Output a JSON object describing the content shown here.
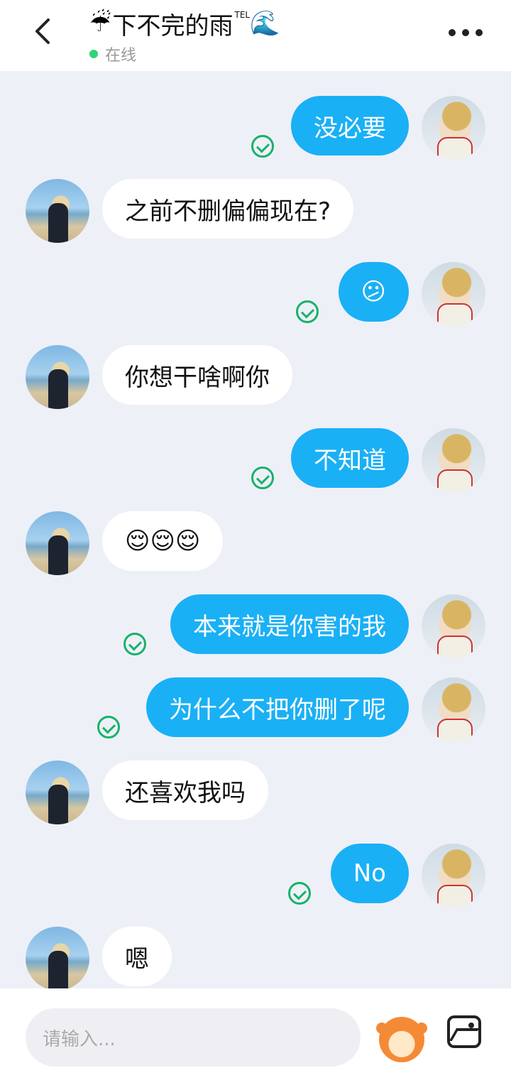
{
  "header": {
    "title_emoji_left": "☔",
    "title": "下不完的雨",
    "title_superscript": "TEL",
    "title_emoji_right": "🌊",
    "status": "在线",
    "status_color": "#2ed573"
  },
  "messages": [
    {
      "side": "out",
      "text": "没必要",
      "read": true
    },
    {
      "side": "in",
      "text": "之前不删偏偏现在?"
    },
    {
      "side": "out",
      "text": "😕",
      "read": true
    },
    {
      "side": "in",
      "text": "你想干啥啊你"
    },
    {
      "side": "out",
      "text": "不知道",
      "read": true
    },
    {
      "side": "in",
      "text": "😌😌😌"
    },
    {
      "side": "out",
      "text": "本来就是你害的我",
      "read": true
    },
    {
      "side": "out",
      "text": "为什么不把你删了呢",
      "read": true
    },
    {
      "side": "in",
      "text": "还喜欢我吗"
    },
    {
      "side": "out",
      "text": "No",
      "read": true
    },
    {
      "side": "in",
      "text": "嗯"
    }
  ],
  "input": {
    "placeholder": "请输入..."
  },
  "colors": {
    "outgoing_bubble": "#1ab0f5",
    "incoming_bubble": "#ffffff",
    "read_check": "#17b26a"
  }
}
